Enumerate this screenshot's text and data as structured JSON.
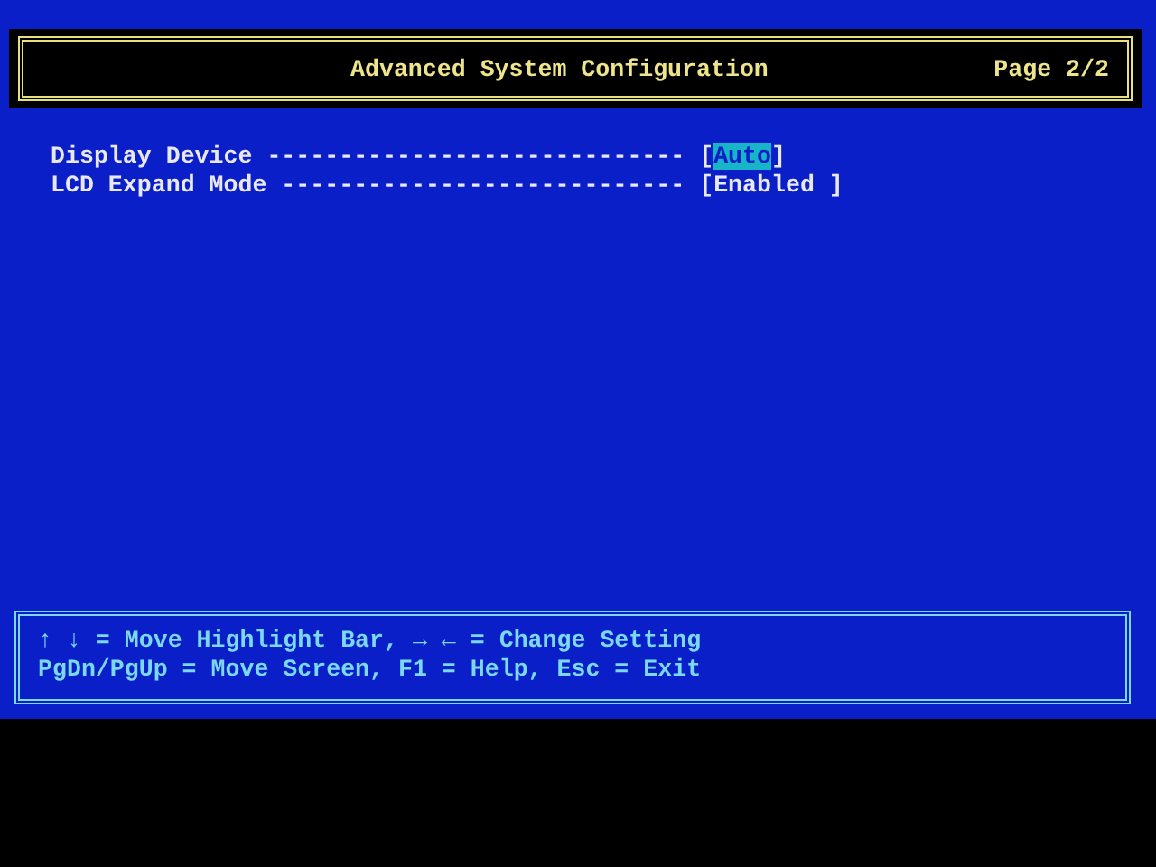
{
  "header": {
    "title": "Advanced System Configuration",
    "page": "Page 2/2"
  },
  "settings": [
    {
      "label": "Display Device",
      "leader": "-----------------------------",
      "open": "[",
      "value": "Auto",
      "close": "]",
      "selected": true
    },
    {
      "label": "LCD Expand Mode",
      "leader": "----------------------------",
      "open": "[",
      "value": "Enabled ",
      "close": "]",
      "selected": false
    }
  ],
  "help": [
    "↑ ↓ = Move Highlight Bar, → ← = Change Setting",
    "PgDn/PgUp = Move Screen, F1 = Help, Esc = Exit"
  ]
}
